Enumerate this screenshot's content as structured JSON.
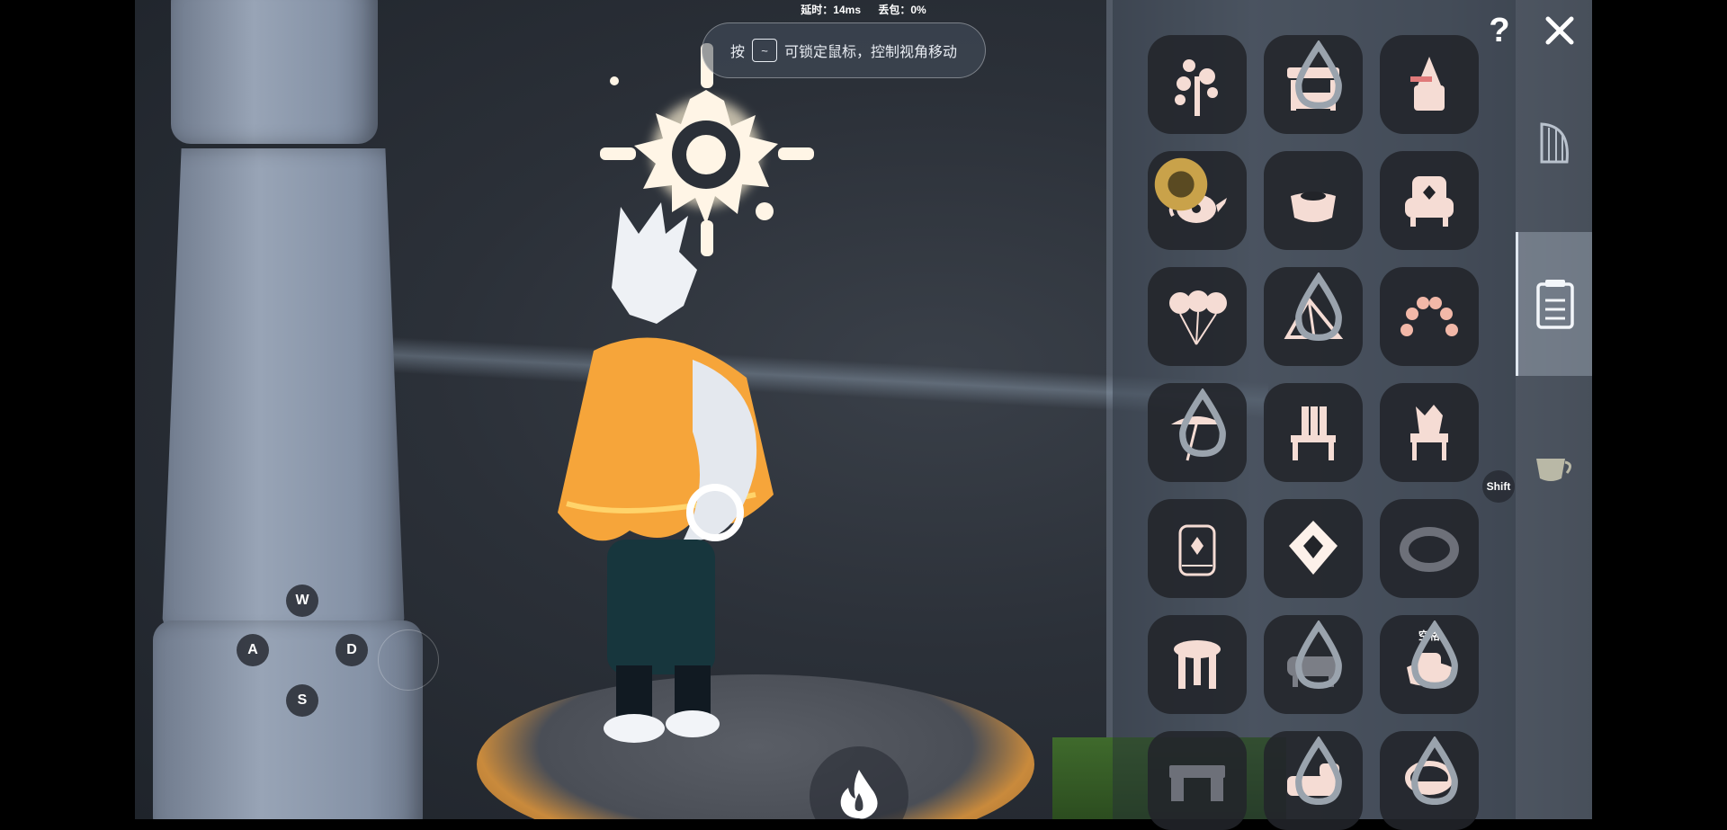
{
  "hud": {
    "latency_label": "延时：14ms",
    "packet_loss_label": "丢包：0%",
    "hint_prefix": "按",
    "hint_key": "~",
    "hint_text": "可锁定鼠标，控制视角移动"
  },
  "movement_keys": {
    "up": "W",
    "left": "A",
    "right": "D",
    "down": "S"
  },
  "panel": {
    "slot_badge_text": "空格",
    "shift_label": "Shift",
    "items": [
      {
        "icon": "sapling-icon",
        "drop": false
      },
      {
        "icon": "market-stall-icon",
        "drop": true
      },
      {
        "icon": "lantern-totem-icon",
        "drop": false
      },
      {
        "icon": "teapot-icon",
        "drop": false,
        "gear": true
      },
      {
        "icon": "tea-bowl-icon",
        "drop": false
      },
      {
        "icon": "armchair-icon",
        "drop": false
      },
      {
        "icon": "sky-balloons-icon",
        "drop": false
      },
      {
        "icon": "tent-icon",
        "drop": true
      },
      {
        "icon": "flower-arch-icon",
        "drop": false
      },
      {
        "icon": "parasol-icon",
        "drop": true
      },
      {
        "icon": "deck-chair-icon",
        "drop": false
      },
      {
        "icon": "ornate-chair-icon",
        "drop": false
      },
      {
        "icon": "stone-lantern-icon",
        "drop": false
      },
      {
        "icon": "hanging-lamp-icon",
        "drop": false
      },
      {
        "icon": "ring-cushion-icon",
        "drop": false
      },
      {
        "icon": "stool-icon",
        "drop": false
      },
      {
        "icon": "sofa-icon",
        "drop": true
      },
      {
        "icon": "cushion-seat-icon",
        "drop": true,
        "badge": true
      },
      {
        "icon": "desk-icon",
        "drop": false
      },
      {
        "icon": "bed-icon",
        "drop": true
      },
      {
        "icon": "basin-icon",
        "drop": true
      }
    ]
  },
  "colors": {
    "icon_fill": "#f5dcd4",
    "icon_stroke": "#f5dcd4",
    "slot_bg": "#222429",
    "tab_active": "#dfe6ef"
  }
}
